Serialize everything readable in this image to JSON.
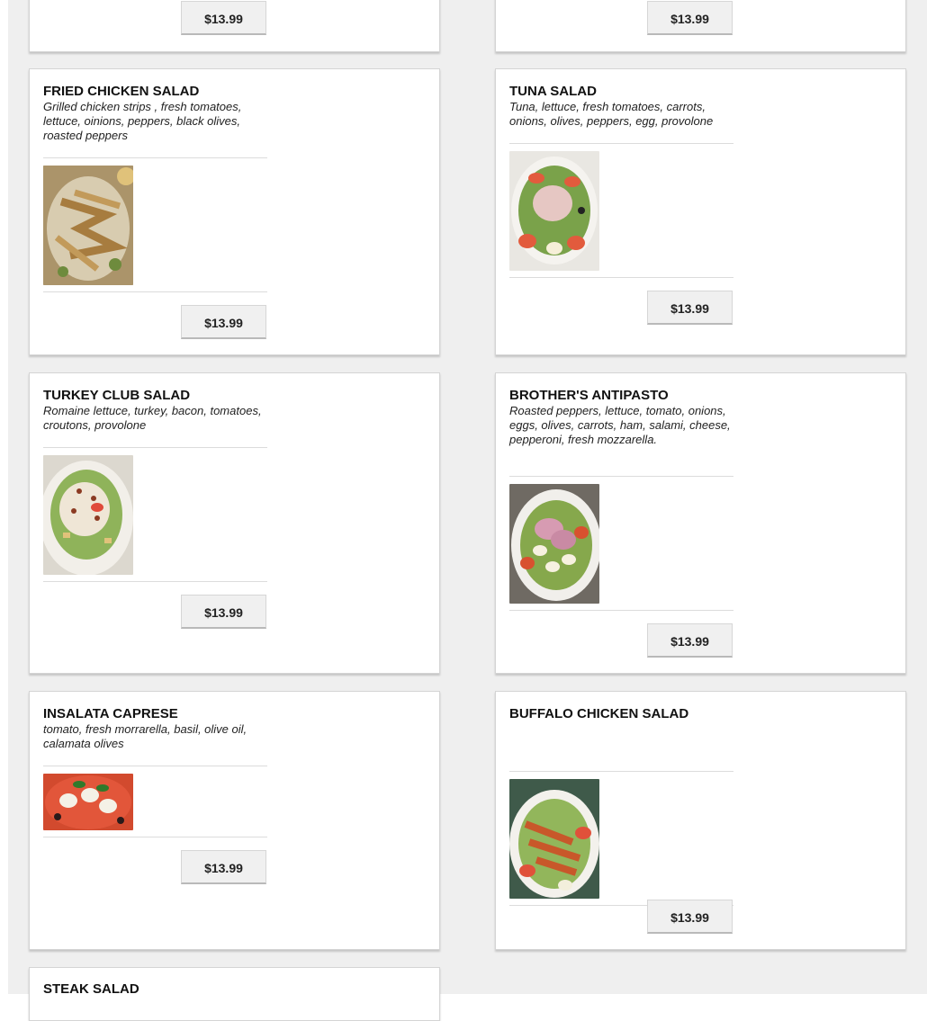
{
  "colors": {
    "page_bg": "#efefef",
    "card_bg": "#ffffff",
    "button_bg": "#f0f0f0"
  },
  "top_row": {
    "left_price": "$13.99",
    "right_price": "$13.99"
  },
  "items": [
    {
      "id": "fried-chicken-salad",
      "name": "FRIED CHICKEN SALAD",
      "description": "Grilled chicken strips , fresh tomatoes, lettuce, oinions, peppers, black olives, roasted peppers",
      "image_icon": "salad-photo",
      "price": "$13.99"
    },
    {
      "id": "tuna-salad",
      "name": "TUNA SALAD",
      "description": "Tuna, lettuce, fresh tomatoes, carrots, onions, olives, peppers, egg, provolone",
      "image_icon": "salad-photo",
      "price": "$13.99"
    },
    {
      "id": "turkey-club-salad",
      "name": "TURKEY CLUB SALAD",
      "description": "Romaine lettuce, turkey, bacon, tomatoes, croutons, provolone",
      "image_icon": "salad-photo",
      "price": "$13.99"
    },
    {
      "id": "brothers-antipasto",
      "name": "BROTHER'S ANTIPASTO",
      "description": "Roasted peppers, lettuce, tomato, onions, eggs, olives, carrots, ham, salami, cheese, pepperoni, fresh mozzarella.",
      "image_icon": "salad-photo",
      "price": "$13.99"
    },
    {
      "id": "insalata-caprese",
      "name": "INSALATA CAPRESE",
      "description": "tomato, fresh morrarella, basil, olive oil, calamata olives",
      "image_icon": "salad-photo",
      "price": "$13.99"
    },
    {
      "id": "buffalo-chicken-salad",
      "name": "BUFFALO CHICKEN SALAD",
      "description": "",
      "image_icon": "salad-photo",
      "price": "$13.99"
    },
    {
      "id": "steak-salad",
      "name": "STEAK SALAD"
    }
  ]
}
